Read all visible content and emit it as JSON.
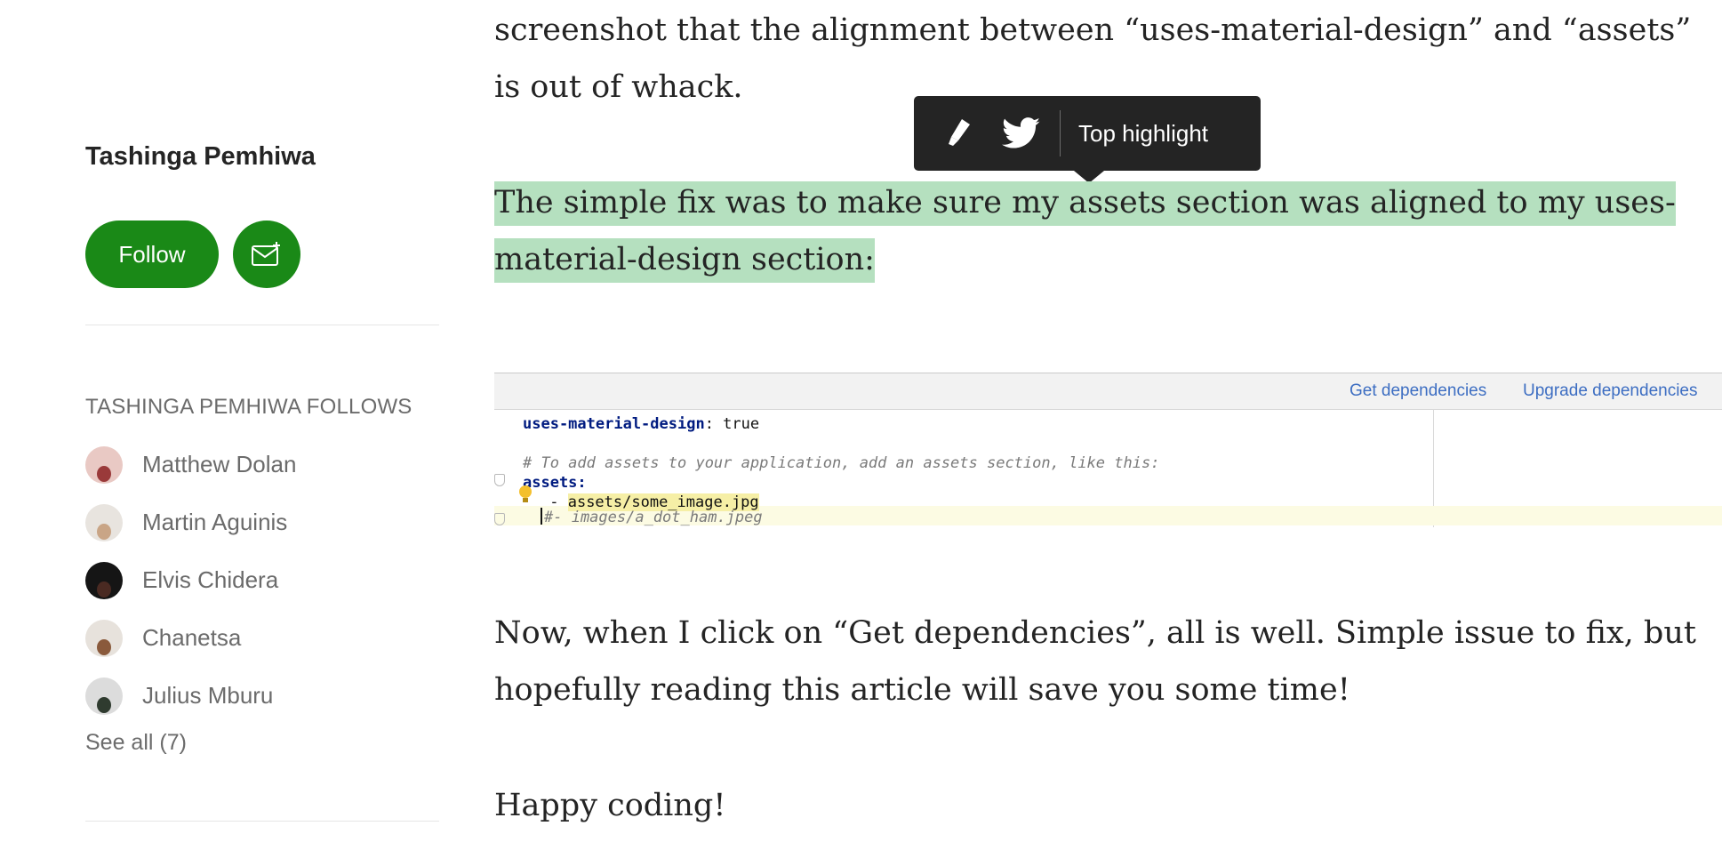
{
  "sidebar": {
    "author_name": "Tashinga Pemhiwa",
    "follow_label": "Follow",
    "follows_heading": "TASHINGA PEMHIWA FOLLOWS",
    "follows": [
      {
        "name": "Matthew Dolan",
        "avatar_color": "#9a3a3a"
      },
      {
        "name": "Martin Aguinis",
        "avatar_color": "#c9a586"
      },
      {
        "name": "Elvis Chidera",
        "avatar_color": "#2a2a2a"
      },
      {
        "name": "Chanetsa",
        "avatar_color": "#8a5a3c"
      },
      {
        "name": "Julius Mburu",
        "avatar_color": "#5a6b5a"
      }
    ],
    "see_all": "See all (7)"
  },
  "article": {
    "para_top": "screenshot that the alignment between “uses-material-design” and “assets” is out of whack.",
    "para_highlight": "The simple fix was to make sure my assets section was aligned to my uses-material-design section:",
    "para_now": "Now, when I click on “Get dependencies”, all is well. Simple issue to fix, but hopefully reading this article will save you some time!",
    "para_happy": "Happy coding!"
  },
  "highlight_toolbar": {
    "label": "Top highlight",
    "icons": [
      "highlighter-icon",
      "twitter-icon"
    ]
  },
  "ide": {
    "get_dependencies": "Get dependencies",
    "upgrade_dependencies": "Upgrade dependencies",
    "line1_key": "uses-material-design",
    "line1_rest": ": true",
    "line2_comment": "# To add assets to your application, add an assets section, like this:",
    "line3_key": "assets",
    "line3_colon": ":",
    "line4_dash": " - ",
    "line4_value": "assets/some_image.jpg",
    "line5_comment": "#- images/a_dot_ham.jpeg"
  },
  "colors": {
    "brand_green": "#1a8917",
    "highlight_green": "#b5e0bf",
    "toolbar_bg": "#242424"
  }
}
